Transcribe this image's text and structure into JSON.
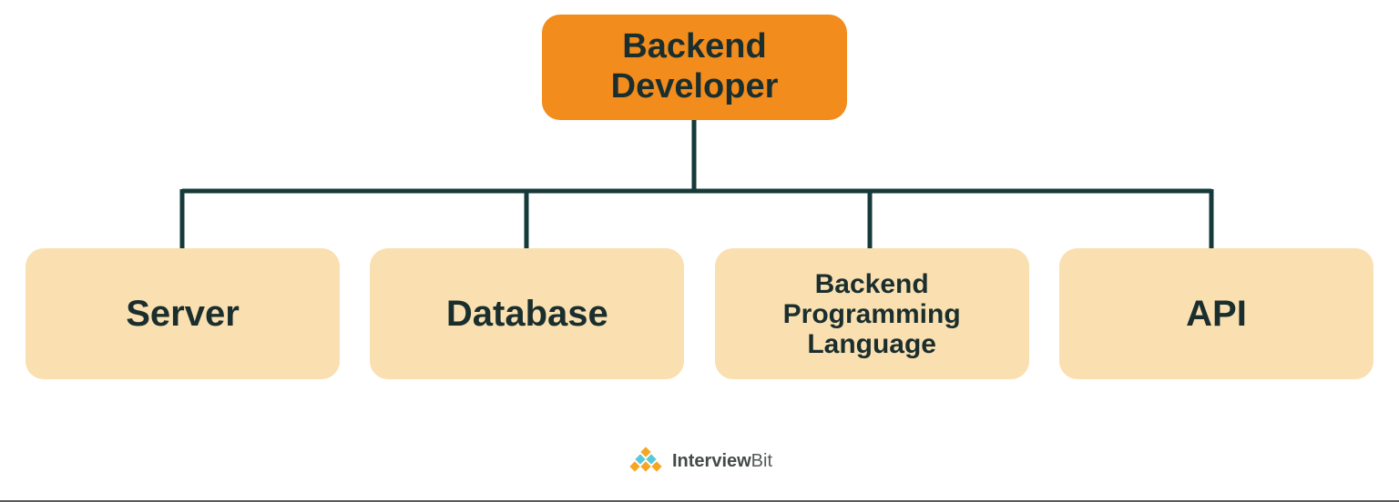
{
  "diagram": {
    "root": {
      "label_line1": "Backend",
      "label_line2": "Developer",
      "color": "#f28c1c"
    },
    "children": [
      {
        "label": "Server",
        "color": "#fadfb0"
      },
      {
        "label": "Database",
        "color": "#fadfb0"
      },
      {
        "label": "Backend Programming Language",
        "color": "#fadfb0"
      },
      {
        "label": "API",
        "color": "#fadfb0"
      }
    ]
  },
  "footer": {
    "brand_strong": "Interview",
    "brand_light": "Bit"
  }
}
